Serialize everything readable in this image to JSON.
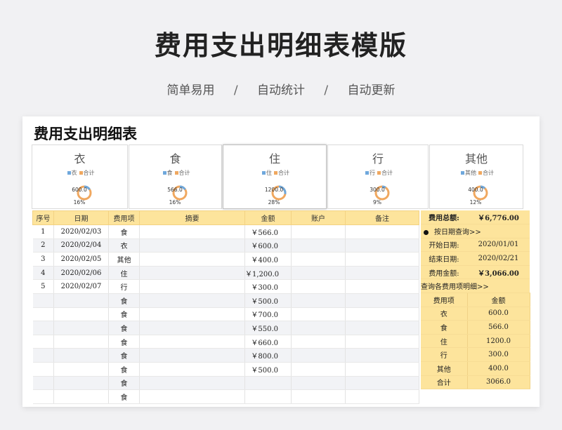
{
  "hero": {
    "title": "费用支出明细表模版",
    "features": [
      "简单易用",
      "自动统计",
      "自动更新"
    ],
    "separator": "/"
  },
  "sheet": {
    "title": "费用支出明细表",
    "cards": [
      {
        "title": "衣",
        "legend_item": "衣",
        "legend_total": "合计",
        "value_text": "600.0",
        "percent": "16%",
        "fraction": 0.16
      },
      {
        "title": "食",
        "legend_item": "食",
        "legend_total": "合计",
        "value_text": "566.0",
        "percent": "16%",
        "fraction": 0.16
      },
      {
        "title": "住",
        "legend_item": "住",
        "legend_total": "合计",
        "value_text": "1200.0",
        "percent": "28%",
        "fraction": 0.28
      },
      {
        "title": "行",
        "legend_item": "行",
        "legend_total": "合计",
        "value_text": "300.0",
        "percent": "9%",
        "fraction": 0.09
      },
      {
        "title": "其他",
        "legend_item": "其他",
        "legend_total": "合计",
        "value_text": "400.0",
        "percent": "12%",
        "fraction": 0.12
      }
    ],
    "colors": {
      "item": "#6fa8dc",
      "total": "#f0a860",
      "header_bg": "#fde49c",
      "stripe": "#f2f3f6"
    },
    "table": {
      "headers": [
        "序号",
        "日期",
        "费用项",
        "摘要",
        "金额",
        "账户",
        "备注"
      ],
      "rows": [
        [
          "1",
          "2020/02/03",
          "食",
          "",
          "￥566.0",
          "",
          ""
        ],
        [
          "2",
          "2020/02/04",
          "衣",
          "",
          "￥600.0",
          "",
          ""
        ],
        [
          "3",
          "2020/02/05",
          "其他",
          "",
          "￥400.0",
          "",
          ""
        ],
        [
          "4",
          "2020/02/06",
          "住",
          "",
          "￥1,200.0",
          "",
          ""
        ],
        [
          "5",
          "2020/02/07",
          "行",
          "",
          "￥300.0",
          "",
          ""
        ],
        [
          "",
          "",
          "食",
          "",
          "￥500.0",
          "",
          ""
        ],
        [
          "",
          "",
          "食",
          "",
          "￥700.0",
          "",
          ""
        ],
        [
          "",
          "",
          "食",
          "",
          "￥550.0",
          "",
          ""
        ],
        [
          "",
          "",
          "食",
          "",
          "￥660.0",
          "",
          ""
        ],
        [
          "",
          "",
          "食",
          "",
          "￥800.0",
          "",
          ""
        ],
        [
          "",
          "",
          "食",
          "",
          "￥500.0",
          "",
          ""
        ],
        [
          "",
          "",
          "食",
          "",
          "",
          "",
          ""
        ],
        [
          "",
          "",
          "食",
          "",
          "",
          "",
          ""
        ]
      ]
    },
    "panel": {
      "total_label": "费用总额:",
      "total_value": "￥6,776.00",
      "query_by_date": "按日期查询>>",
      "start_label": "开始日期:",
      "start_value": "2020/01/01",
      "end_label": "结束日期:",
      "end_value": "2020/02/21",
      "amount_label": "费用金额:",
      "amount_value": "￥3,066.00",
      "query_detail": "查询各费用项明细>>",
      "detail_headers": [
        "费用项",
        "金额"
      ],
      "detail_rows": [
        [
          "衣",
          "600.0"
        ],
        [
          "食",
          "566.0"
        ],
        [
          "住",
          "1200.0"
        ],
        [
          "行",
          "300.0"
        ],
        [
          "其他",
          "400.0"
        ],
        [
          "合计",
          "3066.0"
        ]
      ]
    }
  }
}
